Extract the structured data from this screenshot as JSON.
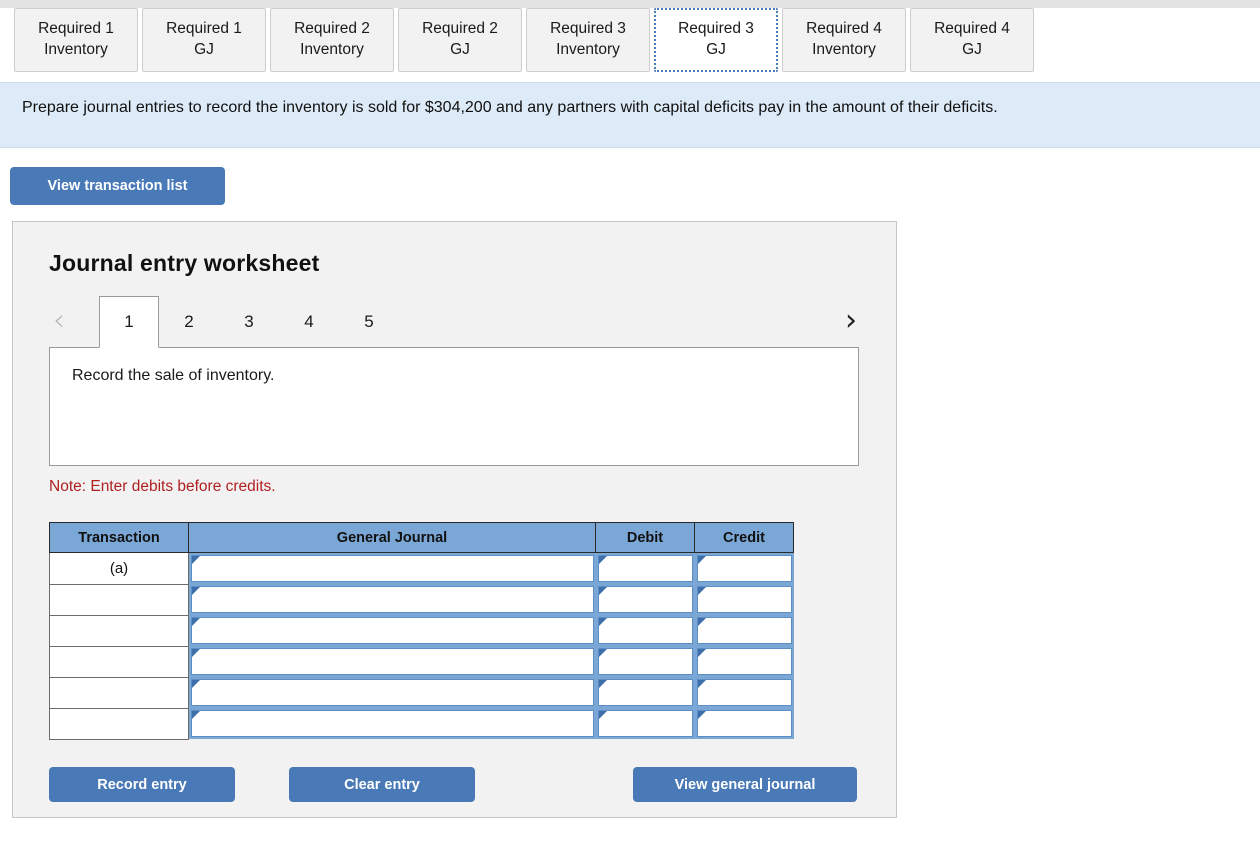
{
  "tabs": [
    {
      "line1": "Required 1",
      "line2": "Inventory",
      "active": false
    },
    {
      "line1": "Required 1",
      "line2": "GJ",
      "active": false
    },
    {
      "line1": "Required 2",
      "line2": "Inventory",
      "active": false
    },
    {
      "line1": "Required 2",
      "line2": "GJ",
      "active": false
    },
    {
      "line1": "Required 3",
      "line2": "Inventory",
      "active": false
    },
    {
      "line1": "Required 3",
      "line2": "GJ",
      "active": true
    },
    {
      "line1": "Required 4",
      "line2": "Inventory",
      "active": false
    },
    {
      "line1": "Required 4",
      "line2": "GJ",
      "active": false
    }
  ],
  "banner": {
    "text": "Prepare journal entries to record the inventory is sold for $304,200 and any partners with capital deficits pay in the amount of their deficits."
  },
  "toolbar": {
    "view_transaction_list_label": "View transaction list"
  },
  "worksheet": {
    "title": "Journal entry worksheet",
    "pager": {
      "prev_icon": "chevron-left",
      "next_icon": "chevron-right",
      "prev_glyph": "‹",
      "next_glyph": "›",
      "pages": [
        "1",
        "2",
        "3",
        "4",
        "5"
      ],
      "active_page": "1"
    },
    "description": "Record the sale of inventory.",
    "note": "Note: Enter debits before credits.",
    "table": {
      "headers": [
        "Transaction",
        "General Journal",
        "Debit",
        "Credit"
      ],
      "rows": [
        {
          "transaction": "(a)",
          "general_journal": "",
          "debit": "",
          "credit": ""
        },
        {
          "transaction": "",
          "general_journal": "",
          "debit": "",
          "credit": ""
        },
        {
          "transaction": "",
          "general_journal": "",
          "debit": "",
          "credit": ""
        },
        {
          "transaction": "",
          "general_journal": "",
          "debit": "",
          "credit": ""
        },
        {
          "transaction": "",
          "general_journal": "",
          "debit": "",
          "credit": ""
        },
        {
          "transaction": "",
          "general_journal": "",
          "debit": "",
          "credit": ""
        }
      ]
    },
    "buttons": {
      "record_entry": "Record entry",
      "clear_entry": "Clear entry",
      "view_general_journal": "View general journal"
    }
  },
  "colors": {
    "button_blue": "#4a79b8",
    "banner_blue": "#ddeaf7",
    "table_header_blue": "#7ba7d7",
    "note_red": "#b02020",
    "panel_gray": "#f2f2f2"
  }
}
